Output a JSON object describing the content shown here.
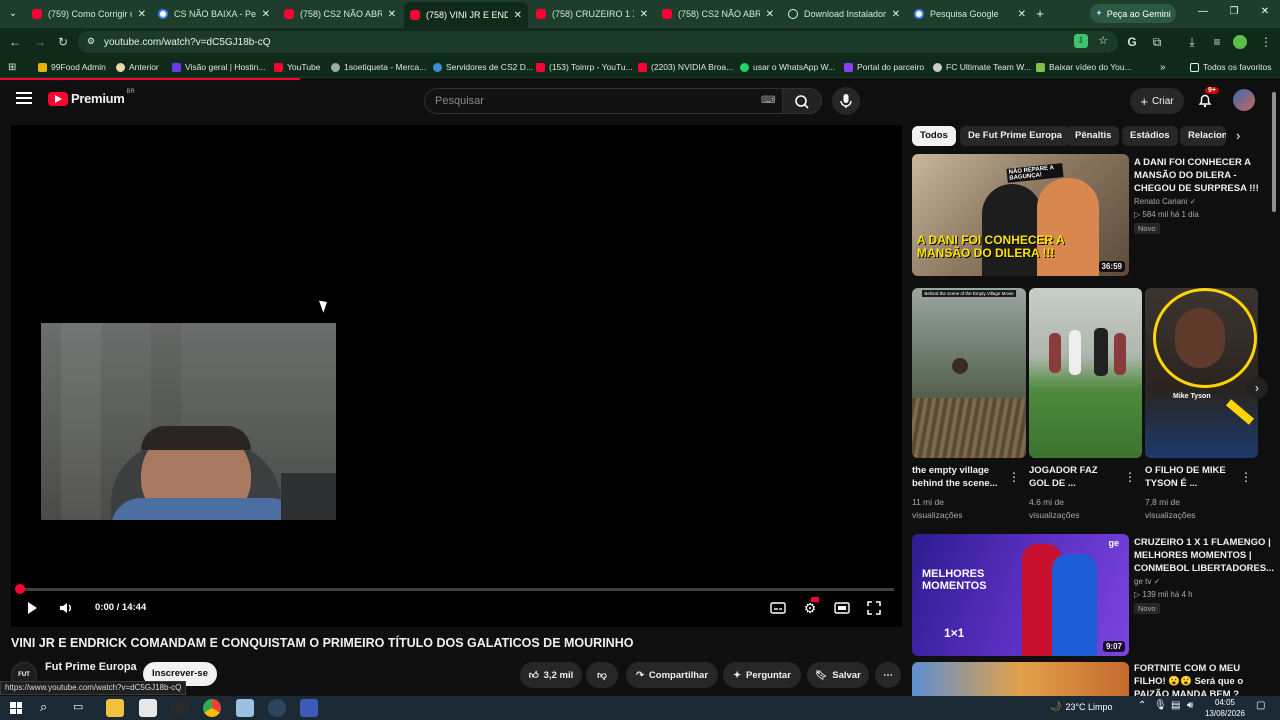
{
  "browser": {
    "tabs": [
      {
        "title": "(759) Como Corrigir o",
        "icon": "youtube-icon"
      },
      {
        "title": "CS NÃO BAIXA - Pesq",
        "icon": "google-icon"
      },
      {
        "title": "(758) CS2 NÃO ABRE",
        "icon": "youtube-icon"
      },
      {
        "title": "(758) VINI JR E ENDRI",
        "icon": "youtube-icon"
      },
      {
        "title": "(758) CRUZEIRO 1 X 1",
        "icon": "youtube-icon"
      },
      {
        "title": "(758) CS2 NÃO ABRE",
        "icon": "youtube-icon"
      },
      {
        "title": "Download Instalador",
        "icon": "globe-icon"
      },
      {
        "title": "Pesquisa Google",
        "icon": "google-icon"
      }
    ],
    "gemini_label": "Peça ao Gemini",
    "url": "youtube.com/watch?v=dC5GJ18b-cQ",
    "bookmarks": [
      {
        "label": "99Food Admin"
      },
      {
        "label": "Anterior"
      },
      {
        "label": "Visão geral | Hostin..."
      },
      {
        "label": "YouTube"
      },
      {
        "label": "1soetiqueta - Merca..."
      },
      {
        "label": "Servidores de CS2 D..."
      },
      {
        "label": "(153) Toinrp - YouTu..."
      },
      {
        "label": "(2203) NVIDIA Broa..."
      },
      {
        "label": "usar o WhatsApp W..."
      },
      {
        "label": "Portal do parceiro"
      },
      {
        "label": "FC Ultimate Team W..."
      },
      {
        "label": "Baixar vídeo do You..."
      }
    ],
    "all_bookmarks": "Todos os favoritos",
    "status_url": "https://www.youtube.com/watch?v=dC5GJ18b-cQ"
  },
  "youtube": {
    "logo": "Premium",
    "region": "BR",
    "search_placeholder": "Pesquisar",
    "create_label": "Criar",
    "notif_count": "9+",
    "player": {
      "time": "0:00 / 14:44"
    },
    "video": {
      "title": "VINI JR E ENDRICK COMANDAM E CONQUISTAM O PRIMEIRO TÍTULO DOS GALATICOS DE MOURINHO",
      "channel": "Fut Prime Europa",
      "channel_avatar_text": "FUT",
      "subscribe": "Inscrever-se",
      "likes": "3,2 mil",
      "share": "Compartilhar",
      "ask": "Perguntar",
      "save": "Salvar"
    },
    "chips": [
      "Todos",
      "De Fut Prime Europa",
      "Pênaltis",
      "Estádios",
      "Relacion"
    ],
    "recs": [
      {
        "title_l1": "A DANI FOI CONHECER A",
        "title_l2": "MANSÃO DO DILERA -",
        "title_l3": "CHEGOU DE SURPRESA !!!",
        "channel": "Renato Cariani",
        "meta": "▷ 584 mil  há 1 dia",
        "badge": "Novo",
        "duration": "36:59",
        "thumb_text": "A DANI FOI CONHECER A MANSÃO DO DILERA !!!",
        "thumb_text2": "NÃO REPARE A BAGUNÇA!"
      },
      {
        "title_l1": "CRUZEIRO 1 X 1 FLAMENGO |",
        "title_l2": "MELHORES MOMENTOS |",
        "title_l3": "CONMEBOL LIBERTADORES...",
        "channel": "ge tv",
        "meta": "▷ 139 mil  há 4 h",
        "badge": "Novo",
        "duration": "9:07",
        "thumb_text": "MELHORES MOMENTOS",
        "score": "1×1"
      },
      {
        "title_l1": "FORTNITE COM O MEU",
        "title_l2": "FILHO! 😮😮 Será que o",
        "title_l3": "PAIZÃO MANDA BEM ?"
      }
    ],
    "shorts": [
      {
        "title_l1": "the empty village",
        "title_l2": "behind the scene...",
        "meta_l1": "11 mi de",
        "meta_l2": "visualizações",
        "thumb_text": "Behind the scene of the Empty Village Movie"
      },
      {
        "title_l1": "JOGADOR FAZ",
        "title_l2": "GOL DE ...",
        "meta_l1": "4,6 mi de",
        "meta_l2": "visualizações"
      },
      {
        "title_l1": "O FILHO DE MIKE",
        "title_l2": "TYSON É ...",
        "meta_l1": "7,8 mi de",
        "meta_l2": "visualizações",
        "thumb_text": "Mike Tyson"
      }
    ]
  },
  "taskbar": {
    "weather": "23°C  Limpo",
    "time": "04:05",
    "date": "13/08/2026"
  },
  "colors": {
    "accent": "#ff0033",
    "chrome_frame": "#1f3d2c"
  }
}
